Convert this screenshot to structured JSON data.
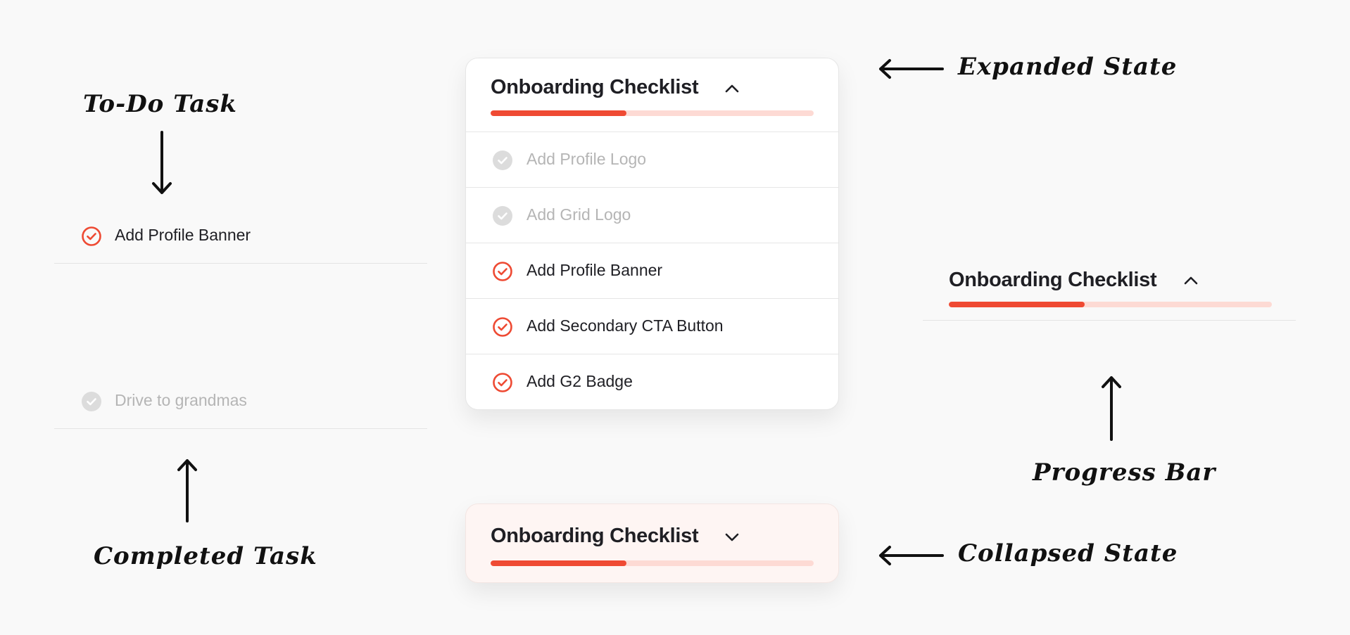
{
  "annotations": {
    "todo_task": "To-Do Task",
    "completed_task": "Completed Task",
    "expanded_state": "Expanded State",
    "collapsed_state": "Collapsed State",
    "progress_bar": "Progress Bar"
  },
  "samples": {
    "todo_label": "Add Profile Banner",
    "done_label": "Drive to grandmas"
  },
  "checklist": {
    "title": "Onboarding Checklist",
    "progress_fraction": 0.42,
    "tasks": [
      {
        "label": "Add Profile Logo",
        "completed": true
      },
      {
        "label": "Add Grid Logo",
        "completed": true
      },
      {
        "label": "Add Profile Banner",
        "completed": false
      },
      {
        "label": "Add Secondary CTA Button",
        "completed": false
      },
      {
        "label": "Add G2 Badge",
        "completed": false
      }
    ]
  },
  "icons": {
    "todo": "check-circle-outline-icon",
    "done": "check-circle-filled-icon",
    "expanded": "chevron-up-icon",
    "collapsed": "chevron-down-icon"
  },
  "colors": {
    "accent": "#ef4a33",
    "track": "#fddad4",
    "collapsed_bg": "#fef5f3",
    "done_text": "#b5b5b5",
    "done_icon": "#dcdcdc"
  }
}
